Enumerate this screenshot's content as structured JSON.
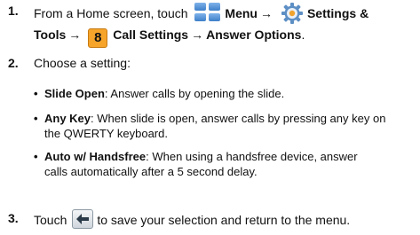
{
  "steps": [
    {
      "number": "1.",
      "line1_prefix": "From a Home screen, touch",
      "menu_label": "Menu",
      "arrow": "→",
      "settings_label": "Settings &",
      "line2_prefix": "Tools",
      "key_number": "8",
      "call_settings": "Call Settings",
      "answer_options": "Answer Options",
      "period": "."
    },
    {
      "number": "2.",
      "text": "Choose a setting:"
    },
    {
      "number": "3.",
      "text_before": "Touch",
      "text_after": "to save your selection and return to the menu."
    }
  ],
  "options": [
    {
      "bullet": "•",
      "name": "Slide Open",
      "line1": ": Answer calls by opening the slide."
    },
    {
      "bullet": "•",
      "name": "Any Key",
      "line1": ": When slide is open, answer calls by pressing any key on",
      "line2": "the QWERTY keyboard."
    },
    {
      "bullet": "•",
      "name": "Auto w/ Handsfree",
      "line1": ": When using a handsfree device, answer",
      "line2": "calls automatically after a 5 second delay."
    }
  ],
  "icons": {
    "menu": "menu-grid-icon",
    "settings": "gear-icon",
    "back": "back-arrow-icon"
  },
  "colors": {
    "menu_icon": "#3e7fc9",
    "key_badge": "#f6a42a",
    "text": "#111111"
  }
}
